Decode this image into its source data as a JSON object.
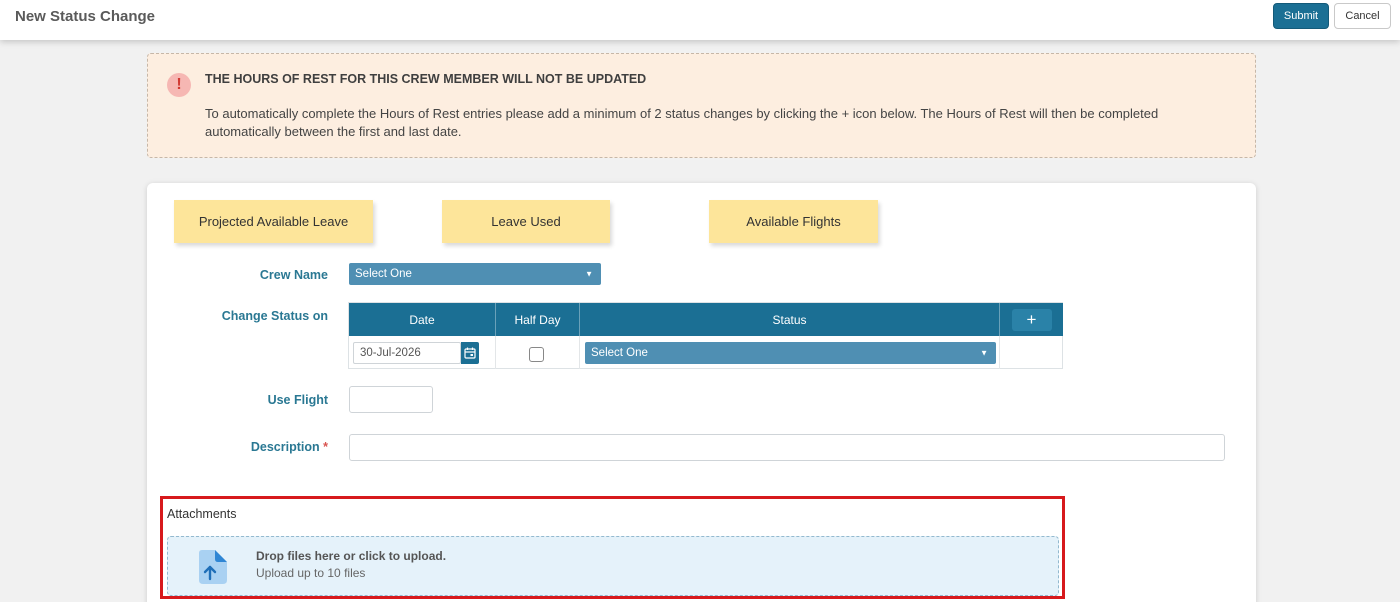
{
  "header": {
    "title": "New Status Change",
    "submit_label": "Submit",
    "cancel_label": "Cancel"
  },
  "alert": {
    "icon": "exclamation-icon",
    "title": "THE HOURS OF REST FOR THIS CREW MEMBER WILL NOT BE UPDATED",
    "text": "To automatically complete the Hours of Rest entries please add a minimum of 2 status changes by clicking the + icon below. The Hours of Rest will then be completed automatically between the first and last date."
  },
  "stats": {
    "projected_leave": "Projected Available Leave",
    "leave_used": "Leave Used",
    "available_flights": "Available Flights"
  },
  "form": {
    "crew_name_label": "Crew Name",
    "crew_name_value": "Select One",
    "change_status_label": "Change Status on",
    "use_flight_label": "Use Flight",
    "description_label": "Description",
    "required_marker": "*"
  },
  "status_grid": {
    "headers": {
      "date": "Date",
      "half_day": "Half Day",
      "status": "Status",
      "add": "+"
    },
    "rows": [
      {
        "date": "30-Jul-2026",
        "half_day": false,
        "status": "Select One"
      }
    ]
  },
  "attachments": {
    "title": "Attachments",
    "drop_main": "Drop files here or click to upload.",
    "drop_sub": "Upload up to 10 files"
  },
  "colors": {
    "primary": "#1b6f94",
    "select_bg": "#4f8fb3",
    "alert_bg": "#fdeee0",
    "stat_bg": "#fde59a",
    "highlight": "#d7191c",
    "label": "#2a7893"
  }
}
